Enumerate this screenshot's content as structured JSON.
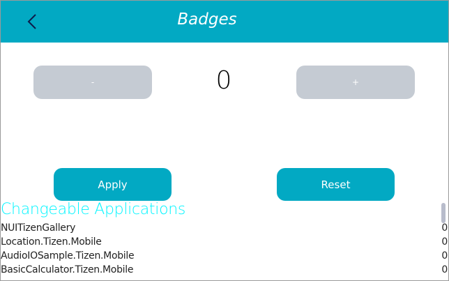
{
  "header": {
    "title": "Badges",
    "back_icon": "chevron-left-icon",
    "color": "#02a9c3"
  },
  "counter": {
    "minus_label": "-",
    "plus_label": "+",
    "value": "0"
  },
  "actions": {
    "apply_label": "Apply",
    "reset_label": "Reset"
  },
  "apps": {
    "title": "Changeable Applications",
    "title_color": "#00f5ff",
    "items": [
      {
        "name": "NUITizenGallery",
        "count": "0"
      },
      {
        "name": "Location.Tizen.Mobile",
        "count": "0"
      },
      {
        "name": "AudioIOSample.Tizen.Mobile",
        "count": "0"
      },
      {
        "name": "BasicCalculator.Tizen.Mobile",
        "count": "0"
      }
    ]
  }
}
